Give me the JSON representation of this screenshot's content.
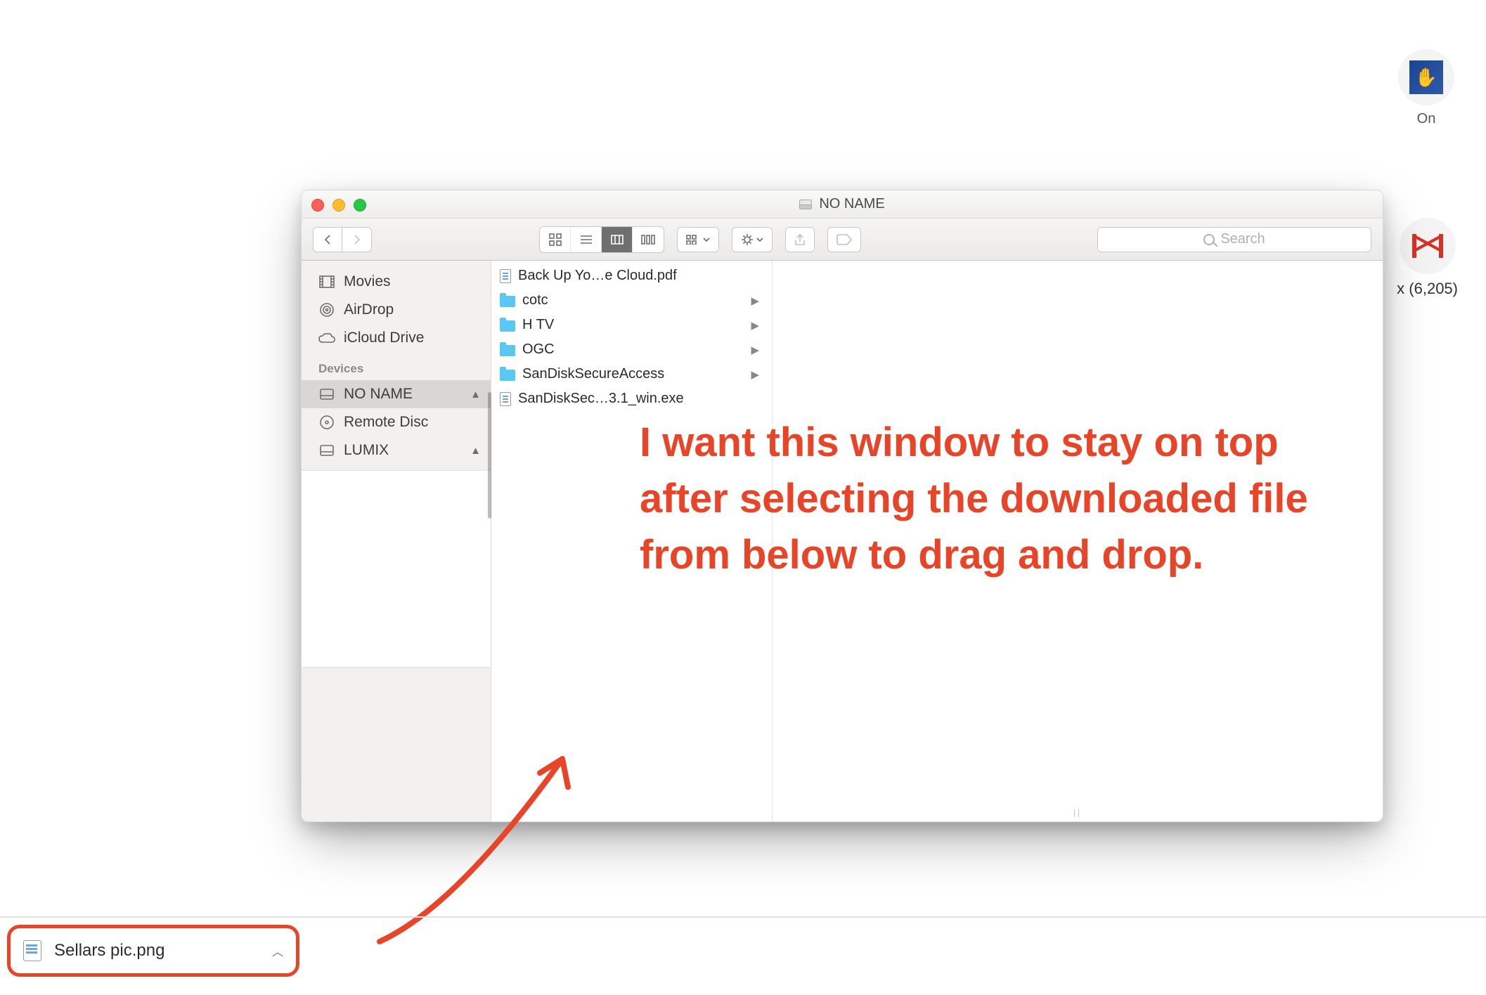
{
  "top_right": {
    "on_label": "On",
    "inbox_label": "x (6,205)"
  },
  "finder": {
    "title": "NO NAME",
    "search_placeholder": "Search",
    "sidebar": {
      "favorites": [
        {
          "label": "Movies",
          "icon": "movies"
        },
        {
          "label": "AirDrop",
          "icon": "airdrop"
        },
        {
          "label": "iCloud Drive",
          "icon": "icloud"
        }
      ],
      "devices_header": "Devices",
      "devices": [
        {
          "label": "NO NAME",
          "icon": "disk",
          "eject": true,
          "selected": true
        },
        {
          "label": "Remote Disc",
          "icon": "optical",
          "eject": false,
          "selected": false
        },
        {
          "label": "LUMIX",
          "icon": "disk",
          "eject": true,
          "selected": false
        }
      ]
    },
    "column_items": [
      {
        "name": "Back Up Yo…e Cloud.pdf",
        "type": "file",
        "arrow": false
      },
      {
        "name": "cotc",
        "type": "folder",
        "arrow": true
      },
      {
        "name": "H TV",
        "type": "folder",
        "arrow": true
      },
      {
        "name": "OGC",
        "type": "folder",
        "arrow": true
      },
      {
        "name": "SanDiskSecureAccess",
        "type": "folder",
        "arrow": true
      },
      {
        "name": "SanDiskSec…3.1_win.exe",
        "type": "file",
        "arrow": false
      }
    ]
  },
  "annotation_text": "I want this window to stay on top after selecting the downloaded file from below to drag and drop.",
  "download_chip": {
    "label": "Sellars pic.png"
  }
}
